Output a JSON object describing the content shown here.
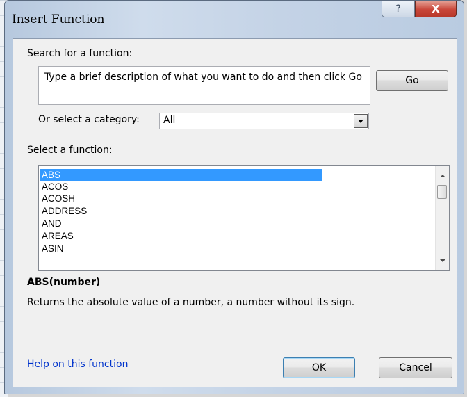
{
  "dialog": {
    "title": "Insert Function",
    "help_glyph": "?",
    "close_glyph": "X"
  },
  "search": {
    "label": "Search for a function:",
    "text": "Type a brief description of what you want to do and then click Go",
    "go_label": "Go"
  },
  "category": {
    "label": "Or select a category:",
    "value": "All"
  },
  "functions": {
    "label": "Select a function:",
    "items": [
      "ABS",
      "ACOS",
      "ACOSH",
      "ADDRESS",
      "AND",
      "AREAS",
      "ASIN"
    ],
    "selected": "ABS"
  },
  "details": {
    "syntax": "ABS(number)",
    "description": "Returns the absolute value of a number, a number without its sign."
  },
  "footer": {
    "help_link": "Help on this function",
    "ok_label": "OK",
    "cancel_label": "Cancel"
  },
  "colors": {
    "selection": "#3399ff",
    "link": "#0033cc",
    "close_button": "#c9473a"
  }
}
